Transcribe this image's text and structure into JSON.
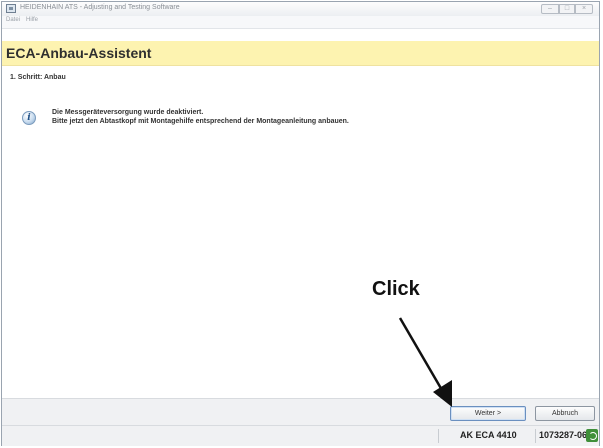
{
  "window": {
    "title": "HEIDENHAIN ATS - Adjusting and Testing Software",
    "controls": {
      "minimize": "–",
      "maximize": "□",
      "close": "×"
    }
  },
  "menu": {
    "items": [
      "Datei",
      "Hilfe"
    ]
  },
  "wizard": {
    "title": "ECA-Anbau-Assistent",
    "step": "1. Schritt: Anbau",
    "info_icon": "info-icon",
    "message_line1": "Die Messgeräteversorgung wurde deaktiviert.",
    "message_line2": "Bitte jetzt den Abtastkopf mit Montagehilfe entsprechend der Montageanleitung anbauen."
  },
  "annotation": {
    "text": "Click"
  },
  "buttons": {
    "next": "Weiter >",
    "abort": "Abbruch"
  },
  "status": {
    "device": "AK ECA 4410",
    "id": "1073287-06",
    "connection_icon": "connection-icon"
  },
  "colors": {
    "header_band": "#fdf3b0",
    "connection": "#3f8f3a"
  }
}
